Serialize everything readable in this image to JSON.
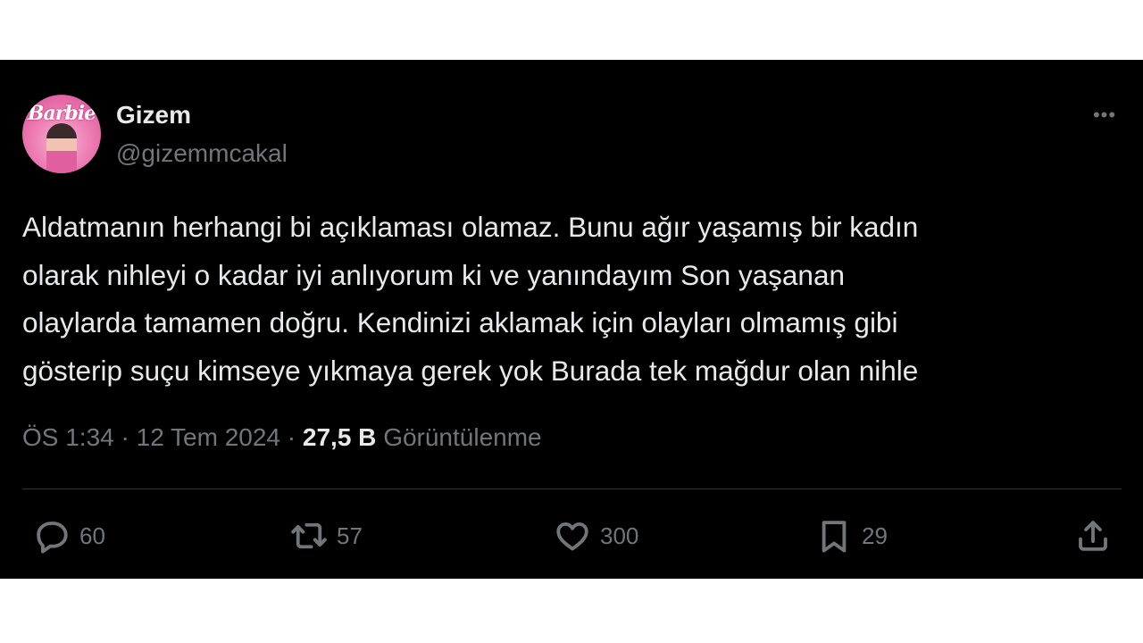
{
  "author": {
    "name": "Gizem",
    "handle": "@gizemmcakal",
    "avatar_logo_text": "Barbie"
  },
  "more_icon": "more-horizontal-icon",
  "tweet": {
    "lines": [
      "Aldatmanın herhangi bi açıklaması olamaz. Bunu ağır yaşamış bir kadın",
      "olarak nihleyi o kadar iyi anlıyorum ki ve yanındayım Son yaşanan",
      "olaylarda tamamen doğru. Kendinizi aklamak için olayları olmamış gibi",
      "gösterip suçu kimseye yıkmaya gerek yok Burada tek mağdur olan nihle"
    ]
  },
  "meta": {
    "time": "ÖS 1:34",
    "separator": "·",
    "date": "12 Tem 2024",
    "views_count": "27,5 B",
    "views_label": "Görüntülenme"
  },
  "actions": {
    "reply": {
      "icon": "reply-icon",
      "count": "60"
    },
    "retweet": {
      "icon": "retweet-icon",
      "count": "57"
    },
    "like": {
      "icon": "heart-icon",
      "count": "300"
    },
    "bookmark": {
      "icon": "bookmark-icon",
      "count": "29"
    },
    "share": {
      "icon": "share-icon"
    }
  },
  "colors": {
    "background": "#000000",
    "text": "#e7e9ea",
    "secondary": "#71767b",
    "divider": "#2f3336",
    "avatar_pink": "#ee7fb5"
  }
}
